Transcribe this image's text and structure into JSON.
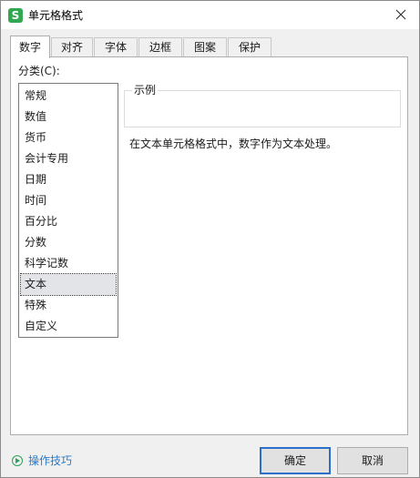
{
  "window": {
    "title": "单元格格式",
    "app_icon_glyph": "S",
    "accent_color": "#2fa84f"
  },
  "tabs": [
    {
      "label": "数字",
      "active": true
    },
    {
      "label": "对齐",
      "active": false
    },
    {
      "label": "字体",
      "active": false
    },
    {
      "label": "边框",
      "active": false
    },
    {
      "label": "图案",
      "active": false
    },
    {
      "label": "保护",
      "active": false
    }
  ],
  "category": {
    "label": "分类(C):",
    "items": [
      "常规",
      "数值",
      "货币",
      "会计专用",
      "日期",
      "时间",
      "百分比",
      "分数",
      "科学记数",
      "文本",
      "特殊",
      "自定义"
    ],
    "selected": "文本"
  },
  "sample": {
    "legend": "示例",
    "value": ""
  },
  "description": "在文本单元格格式中，数字作为文本处理。",
  "footer": {
    "tips_label": "操作技巧",
    "ok_label": "确定",
    "cancel_label": "取消"
  }
}
